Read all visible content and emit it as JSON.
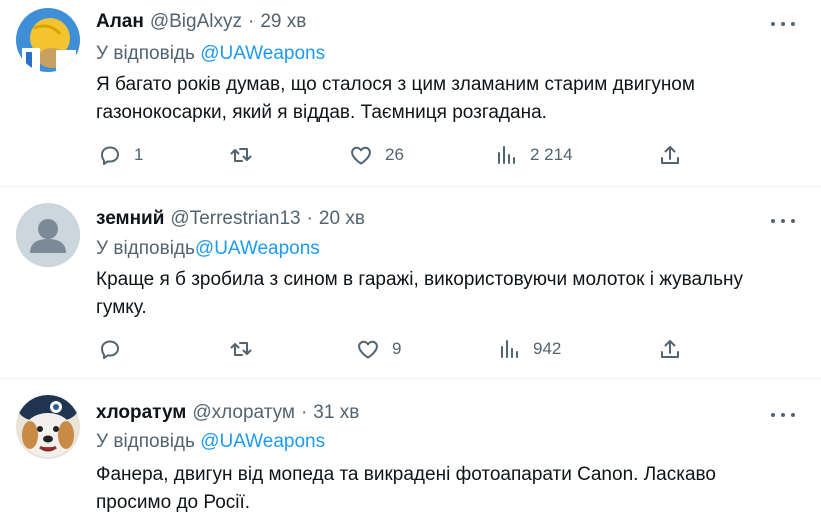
{
  "tweets": [
    {
      "name": "Алан",
      "handle": "@BigAlxyz",
      "sep": "·",
      "time": "29 хв",
      "reply_prefix": "У відповідь",
      "reply_to": "@UAWeapons",
      "text": "Я багато років думав, що сталося з цим зламаним старим двигуном газонокосарки, який я віддав. Таємниця розгадана.",
      "replies": "1",
      "retweets": "",
      "likes": "26",
      "views": "2 214"
    },
    {
      "name": "земний",
      "handle": "@Terrestrian13",
      "sep": "·",
      "time": "20 хв",
      "reply_prefix": "У відповідь",
      "reply_to": "@UAWeapons",
      "text": "Краще я б зробила з сином в гаражі, використовуючи молоток і жувальну гумку.",
      "replies": "",
      "retweets": "",
      "likes": "9",
      "views": "942"
    },
    {
      "name": "хлоратум",
      "handle": "@хлоратум",
      "sep": "·",
      "time": "31 хв",
      "reply_prefix": "У відповідь",
      "reply_to": "@UAWeapons",
      "text": "Фанера, двигун від мопеда та викрадені фотоапарати Canon. Ласкаво просимо до Росії.",
      "replies": "",
      "retweets": "",
      "likes": "",
      "views": ""
    }
  ],
  "icons": {
    "reply": "reply-icon",
    "retweet": "retweet-icon",
    "like": "heart-icon",
    "views": "views-icon",
    "share": "share-icon",
    "more": "more-icon"
  },
  "colors": {
    "accent": "#1d9bf0",
    "secondary_text": "#536471",
    "divider": "#eff3f4"
  }
}
